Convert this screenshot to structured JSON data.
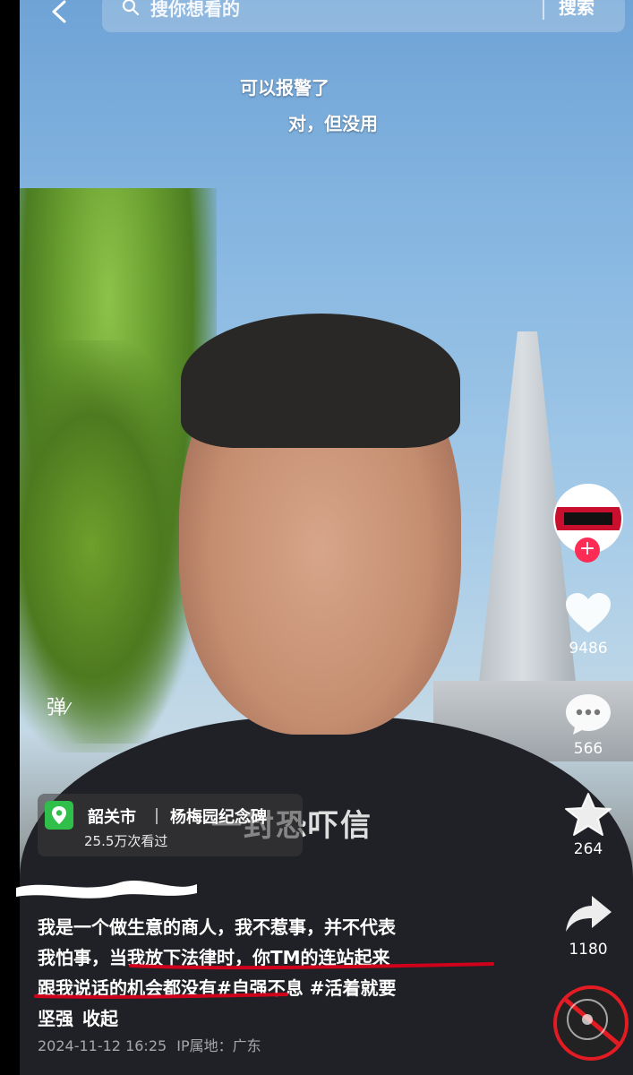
{
  "search": {
    "placeholder": "搜你想看的",
    "button_label": "搜索"
  },
  "danmaku": [
    "可以报警了",
    "对，但没用"
  ],
  "barrage_toggle_label": "弹",
  "video_caption_overlay": "一封恐吓信",
  "location": {
    "city": "韶关市",
    "place": "杨梅园纪念碑",
    "views": "25.5万次看过"
  },
  "description": {
    "line1": "我是一个做生意的商人，我不惹事，并不代表",
    "line2": "我怕事，当我放下法律时，你TM的连站起来",
    "line3_text": "跟我说话的机会都没有",
    "line3_tag1": "#自强不息",
    "line3_tag2": "#活着就要",
    "line4_text": "坚强",
    "collapse_label": "收起"
  },
  "meta": {
    "timestamp": "2024-11-12 16:25",
    "ip_location": "IP属地：广东"
  },
  "actions": {
    "likes": "9486",
    "comments": "566",
    "favorites": "264",
    "shares": "1180"
  },
  "colors": {
    "accent_red": "#fe2c55",
    "underline_red": "#d0021b",
    "pin_green": "#2fbf4a"
  },
  "icons": {
    "back": "chevron-left-icon",
    "search": "search-icon",
    "location": "location-pin-icon",
    "like": "heart-icon",
    "comment": "comment-icon",
    "favorite": "star-icon",
    "share": "share-arrow-icon",
    "follow": "plus-icon",
    "music": "music-disc-icon"
  }
}
